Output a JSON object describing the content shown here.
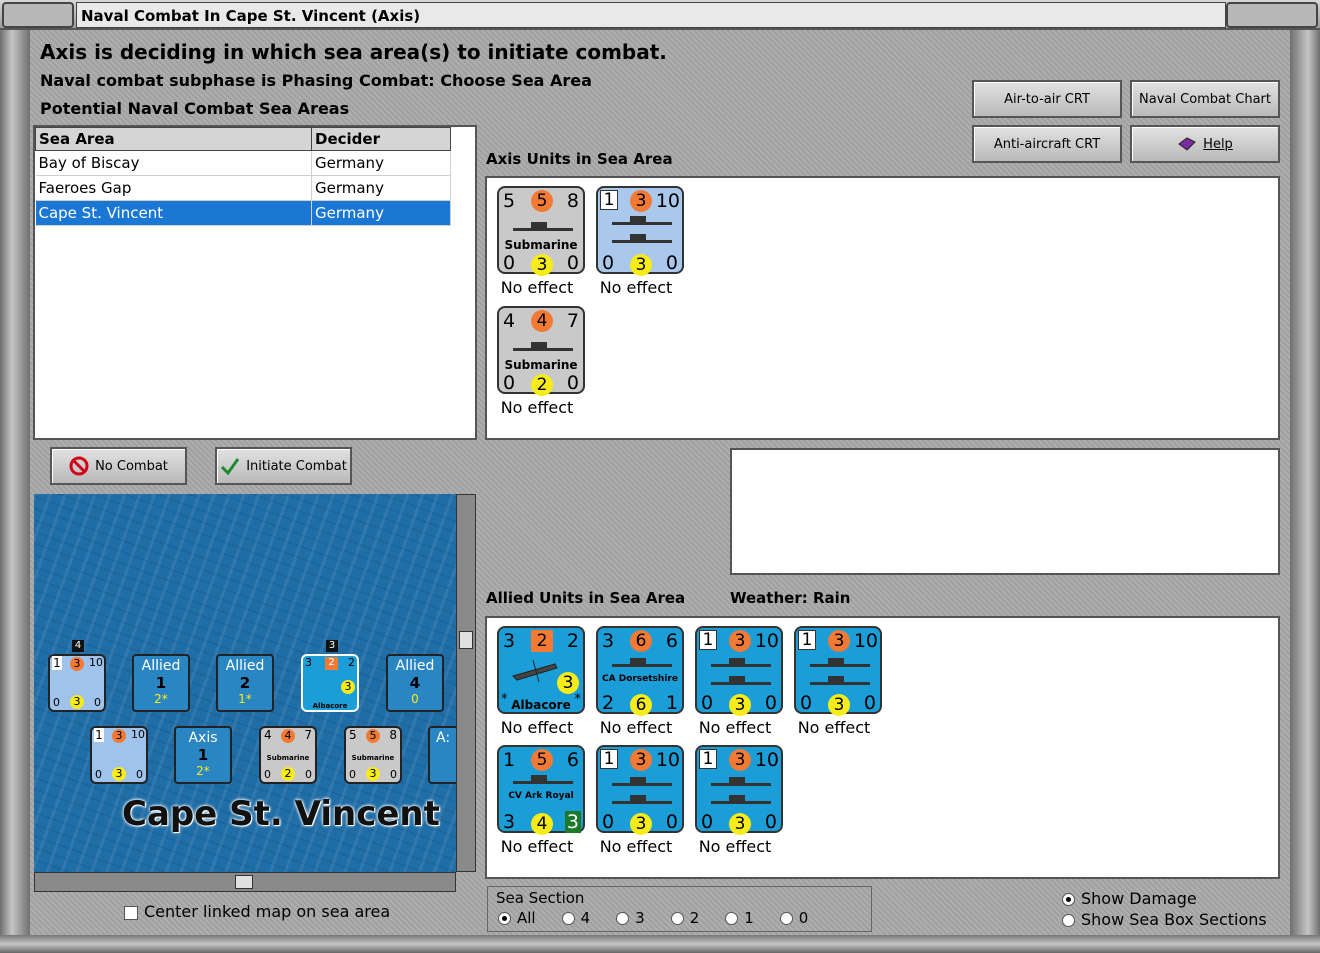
{
  "window": {
    "title": "Naval Combat In Cape St. Vincent (Axis)"
  },
  "header": {
    "line1": "Axis is deciding in which sea area(s) to initiate combat.",
    "line2": "Naval combat subphase is Phasing Combat: Choose Sea Area",
    "line3": "Potential Naval Combat Sea Areas"
  },
  "buttons": {
    "air_to_air": "Air-to-air CRT",
    "naval_chart": "Naval Combat Chart",
    "anti_aircraft": "Anti-aircraft CRT",
    "help": "Help",
    "no_combat": "No Combat",
    "initiate": "Initiate Combat"
  },
  "table": {
    "col1": "Sea Area",
    "col2": "Decider",
    "rows": [
      {
        "area": "Bay of Biscay",
        "decider": "Germany"
      },
      {
        "area": "Faeroes Gap",
        "decider": "Germany"
      },
      {
        "area": "Cape St. Vincent",
        "decider": "Germany"
      }
    ]
  },
  "axis_section": {
    "label": "Axis Units in Sea Area",
    "units": [
      {
        "tl": "5",
        "tm": "5",
        "tr": "8",
        "name": "Submarine",
        "bl": "0",
        "bm": "3",
        "br": "0",
        "effect": "No effect"
      },
      {
        "tl": "1",
        "tm": "3",
        "tr": "10",
        "name": "",
        "bl": "0",
        "bm": "3",
        "br": "0",
        "effect": "No effect"
      },
      {
        "tl": "4",
        "tm": "4",
        "tr": "7",
        "name": "Submarine",
        "bl": "0",
        "bm": "2",
        "br": "0",
        "effect": "No effect"
      }
    ]
  },
  "allied_section": {
    "label": "Allied Units in Sea Area",
    "weather_label": "Weather:",
    "weather": "Rain",
    "units": [
      {
        "tl": "3",
        "tm": "2",
        "tr": "2",
        "name": "Albacore",
        "bl": "*",
        "bm": "3",
        "br": "*",
        "effect": "No effect"
      },
      {
        "tl": "3",
        "tm": "6",
        "tr": "6",
        "name": "CA Dorsetshire",
        "bl": "2",
        "bm": "6",
        "br": "1",
        "effect": "No effect"
      },
      {
        "tl": "1",
        "tm": "3",
        "tr": "10",
        "name": "",
        "bl": "0",
        "bm": "3",
        "br": "0",
        "effect": "No effect"
      },
      {
        "tl": "1",
        "tm": "3",
        "tr": "10",
        "name": "",
        "bl": "0",
        "bm": "3",
        "br": "0",
        "effect": "No effect"
      },
      {
        "tl": "1",
        "tm": "5",
        "tr": "6",
        "name": "CV Ark Royal",
        "bl": "3",
        "bm": "4",
        "br": "3",
        "effect": "No effect"
      },
      {
        "tl": "1",
        "tm": "3",
        "tr": "10",
        "name": "",
        "bl": "0",
        "bm": "3",
        "br": "0",
        "effect": "No effect"
      },
      {
        "tl": "1",
        "tm": "3",
        "tr": "10",
        "name": "",
        "bl": "0",
        "bm": "3",
        "br": "0",
        "effect": "No effect"
      }
    ]
  },
  "map": {
    "name": "Cape St. Vincent",
    "tokens": {
      "allied1": {
        "t": "Allied",
        "n": "1",
        "s": "2*"
      },
      "allied2": {
        "t": "Allied",
        "n": "2",
        "s": "1*"
      },
      "allied3": {
        "t": "Allied",
        "n": "4",
        "s": "0"
      },
      "axis1": {
        "t": "Axis",
        "n": "1",
        "s": "2*"
      },
      "stack4": "4",
      "stack3": "3",
      "partial": "A:"
    },
    "mini": {
      "a": {
        "tl": "1",
        "tm": "3",
        "tr": "10",
        "bl": "0",
        "bm": "3",
        "br": "0"
      },
      "b": {
        "tl": "3",
        "tm": "2",
        "tr": "2",
        "bm": "3",
        "name": "Albacore"
      },
      "c": {
        "tl": "1",
        "tm": "3",
        "tr": "10",
        "bl": "0",
        "bm": "3",
        "br": "0"
      },
      "d": {
        "tl": "4",
        "tm": "4",
        "tr": "7",
        "bl": "0",
        "bm": "2",
        "br": "0",
        "name": "Submarine"
      },
      "e": {
        "tl": "5",
        "tm": "5",
        "tr": "8",
        "bl": "0",
        "bm": "3",
        "br": "0",
        "name": "Submarine"
      }
    },
    "center_label": "Center linked map on sea area"
  },
  "sea_section": {
    "label": "Sea Section",
    "options": [
      "All",
      "4",
      "3",
      "2",
      "1",
      "0"
    ],
    "selected": "All"
  },
  "display": {
    "show_damage": "Show Damage",
    "show_boxes": "Show Sea Box Sections"
  }
}
